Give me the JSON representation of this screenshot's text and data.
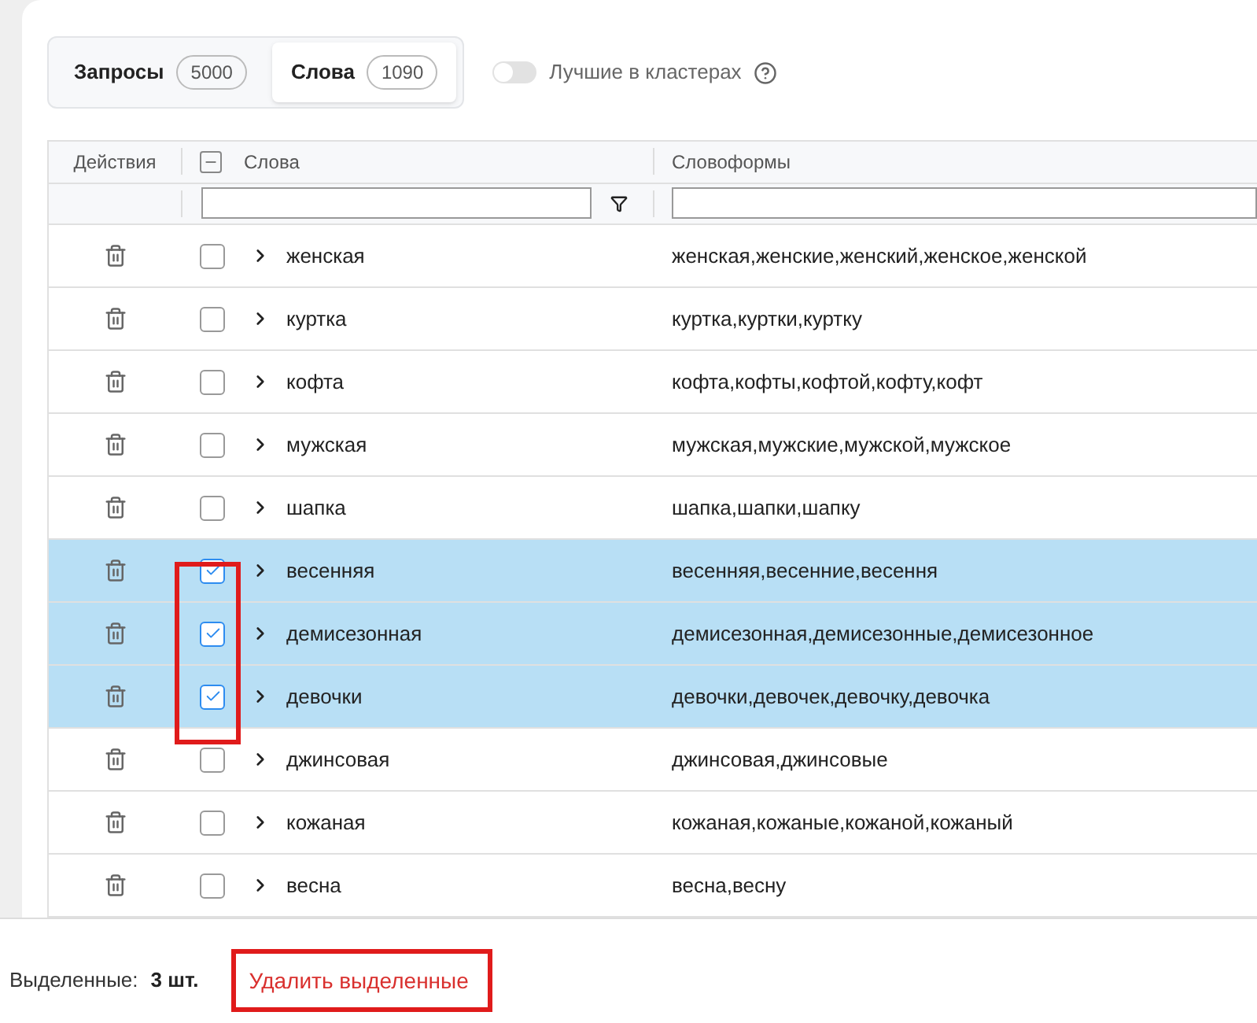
{
  "tabs": [
    {
      "label": "Запросы",
      "count": "5000",
      "selected": false
    },
    {
      "label": "Слова",
      "count": "1090",
      "selected": true
    }
  ],
  "toggle": {
    "label": "Лучшие в кластерах",
    "on": false
  },
  "table": {
    "columns": [
      "Действия",
      "Слова",
      "Словоформы"
    ],
    "select_all_indeterminate": true,
    "rows": [
      {
        "word": "женская",
        "forms": "женская,женские,женский,женское,женской",
        "checked": false
      },
      {
        "word": "куртка",
        "forms": "куртка,куртки,куртку",
        "checked": false
      },
      {
        "word": "кофта",
        "forms": "кофта,кофты,кофтой,кофту,кофт",
        "checked": false
      },
      {
        "word": "мужская",
        "forms": "мужская,мужские,мужской,мужское",
        "checked": false
      },
      {
        "word": "шапка",
        "forms": "шапка,шапки,шапку",
        "checked": false
      },
      {
        "word": "весенняя",
        "forms": "весенняя,весенние,весення",
        "checked": true
      },
      {
        "word": "демисезонная",
        "forms": "демисезонная,демисезонные,демисезонное",
        "checked": true
      },
      {
        "word": "девочки",
        "forms": "девочки,девочек,девочку,девочка",
        "checked": true
      },
      {
        "word": "джинсовая",
        "forms": "джинсовая,джинсовые",
        "checked": false
      },
      {
        "word": "кожаная",
        "forms": "кожаная,кожаные,кожаной,кожаный",
        "checked": false
      },
      {
        "word": "весна",
        "forms": "весна,весну",
        "checked": false
      }
    ]
  },
  "footer": {
    "label": "Выделенные:",
    "count": "3 шт.",
    "action": "Удалить выделенные"
  }
}
